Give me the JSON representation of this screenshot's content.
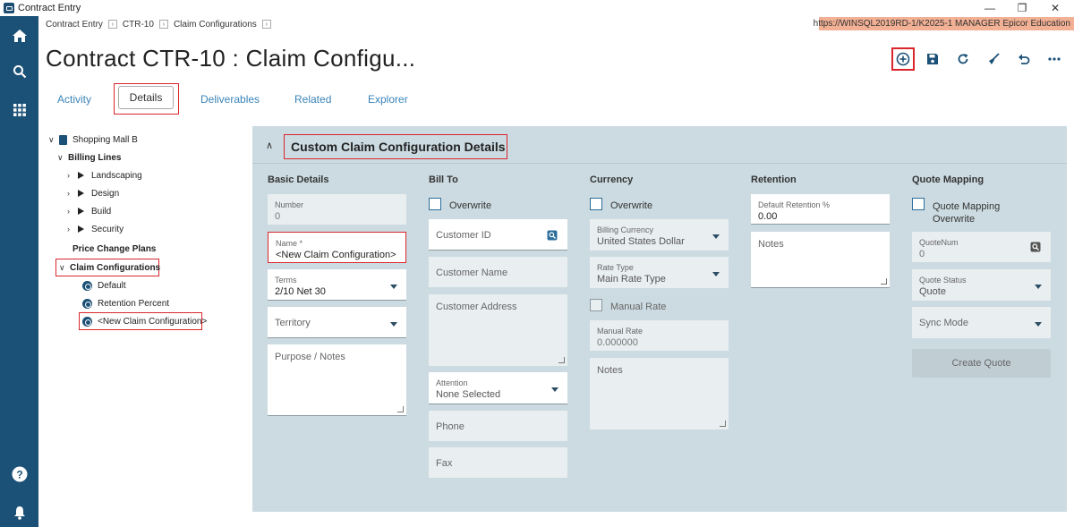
{
  "window": {
    "title": "Contract Entry",
    "minimize": "—",
    "maximize": "❐",
    "close": "✕"
  },
  "breadcrumb": {
    "items": [
      "Contract Entry",
      "CTR-10",
      "Claim Configurations"
    ]
  },
  "environment": {
    "text": "https://WINSQL2019RD-1/K2025-1   MANAGER   Epicor Education"
  },
  "page": {
    "title": "Contract CTR-10 : Claim Configu..."
  },
  "toolbar": {
    "icons": [
      "add-new-icon",
      "save-icon",
      "refresh-icon",
      "clear-icon",
      "undo-icon",
      "more-icon"
    ]
  },
  "tabs": {
    "activity": "Activity",
    "details": "Details",
    "deliverables": "Deliverables",
    "related": "Related",
    "explorer": "Explorer"
  },
  "tree": {
    "root": "Shopping Mall B",
    "billing_lines": "Billing Lines",
    "billing_items": [
      "Landscaping",
      "Design",
      "Build",
      "Security"
    ],
    "price_change_plans": "Price Change Plans",
    "claim_configurations": "Claim Configurations",
    "claim_items": [
      "Default",
      "Retention Percent",
      "<New Claim Configuration>"
    ]
  },
  "panel": {
    "title": "Custom Claim Configuration Details"
  },
  "basic": {
    "heading": "Basic Details",
    "number_label": "Number",
    "number_value": "0",
    "name_label": "Name *",
    "name_value": "<New Claim Configuration>",
    "terms_label": "Terms",
    "terms_value": "2/10 Net 30",
    "territory_label": "Territory",
    "notes_label": "Purpose / Notes"
  },
  "billto": {
    "heading": "Bill To",
    "overwrite": "Overwrite",
    "customer_id": "Customer ID",
    "customer_name": "Customer Name",
    "customer_address": "Customer Address",
    "attention_label": "Attention",
    "attention_value": "None Selected",
    "phone": "Phone",
    "fax": "Fax"
  },
  "currency": {
    "heading": "Currency",
    "overwrite": "Overwrite",
    "billing_currency_label": "Billing Currency",
    "billing_currency_value": "United States Dollar",
    "rate_type_label": "Rate Type",
    "rate_type_value": "Main Rate Type",
    "manual_rate_check": "Manual Rate",
    "manual_rate_label": "Manual Rate",
    "manual_rate_value": "0.000000",
    "notes": "Notes"
  },
  "retention": {
    "heading": "Retention",
    "default_label": "Default Retention %",
    "default_value": "0.00",
    "notes": "Notes"
  },
  "quote": {
    "heading": "Quote Mapping",
    "mapping_check_line1": "Quote Mapping",
    "mapping_check_line2": "Overwrite",
    "quotenum_label": "QuoteNum",
    "quotenum_value": "0",
    "status_label": "Quote Status",
    "status_value": "Quote",
    "sync_mode": "Sync Mode",
    "create_button": "Create Quote"
  },
  "colors": {
    "sidebar": "#1c5177",
    "accent": "#2b6d9b",
    "highlight": "#d9262c",
    "panel": "#ccdbe1",
    "env": "#f2b094"
  }
}
